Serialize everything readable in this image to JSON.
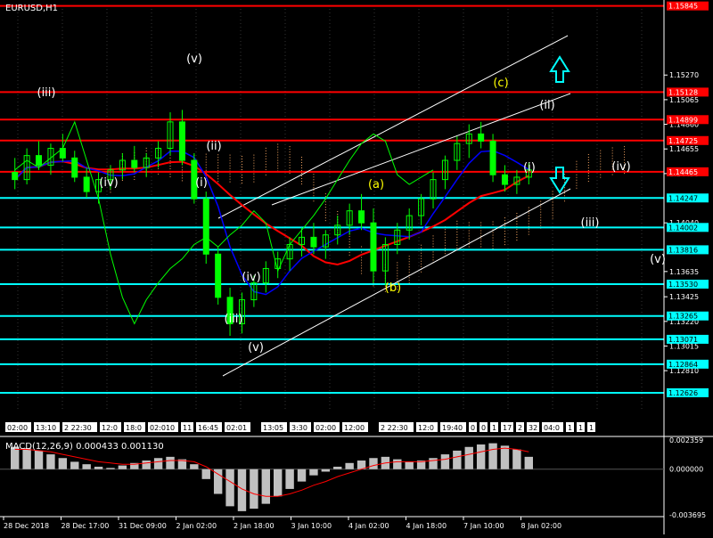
{
  "window": {
    "symbol_title": "EURUSD,H1",
    "macd_title": "MACD(12,26,9) 0.000433 0.001130"
  },
  "colors": {
    "background": "#000000",
    "candle": "#00ff00",
    "line_red": "#ff0000",
    "line_blue": "#0000ff",
    "level_red": "#ff0000",
    "level_cyan": "#00ffff",
    "channel": "#ffffff",
    "wave_white": "#ffffff",
    "wave_yellow": "#ffff00",
    "cloud": "#f4a460",
    "hist": "#c0c0c0",
    "macd_signal": "#ff0000"
  },
  "icons": {
    "up_arrow": "arrow-up-icon",
    "down_arrow": "arrow-down-icon"
  },
  "chart_data": {
    "type": "candlestick",
    "title": "EURUSD,H1",
    "y_axis": {
      "min": 1.1247,
      "max": 1.1585,
      "ticks": [
        "1.15270",
        "1.15065",
        "1.14860",
        "1.14655",
        "1.14450",
        "1.14040",
        "1.13635",
        "1.13425",
        "1.13220",
        "1.13015",
        "1.12810"
      ]
    },
    "price_levels": [
      {
        "value": 1.15845,
        "label": "1.15845",
        "color": "red"
      },
      {
        "value": 1.15128,
        "label": "1.15128",
        "color": "red"
      },
      {
        "value": 1.14899,
        "label": "1.14899",
        "color": "red"
      },
      {
        "value": 1.14725,
        "label": "1.14725",
        "color": "red"
      },
      {
        "value": 1.14465,
        "label": "1.14465",
        "color": "red"
      },
      {
        "value": 1.14247,
        "label": "1.14247",
        "color": "cyan"
      },
      {
        "value": 1.14002,
        "label": "1.14002",
        "color": "cyan"
      },
      {
        "value": 1.13816,
        "label": "1.13816",
        "color": "cyan"
      },
      {
        "value": 1.1353,
        "label": "1.13530",
        "color": "cyan"
      },
      {
        "value": 1.13265,
        "label": "1.13265",
        "color": "cyan"
      },
      {
        "value": 1.13071,
        "label": "1.13071",
        "color": "cyan"
      },
      {
        "value": 1.12864,
        "label": "1.12864",
        "color": "cyan"
      },
      {
        "value": 1.12626,
        "label": "1.12626",
        "color": "cyan"
      }
    ],
    "x_axis_labels": [
      "28 Dec 2018",
      "28 Dec 17:00",
      "31 Dec 09:00",
      "2 Jan 02:00",
      "2 Jan 18:00",
      "3 Jan 10:00",
      "4 Jan 02:00",
      "4 Jan 18:00",
      "7 Jan 10:00",
      "8 Jan 02:00"
    ],
    "time_markers": [
      "02:00",
      "13:10",
      "2 22:30",
      "12:0",
      "18:0",
      "02:010",
      "11",
      "16:45",
      "02:01",
      "13:05",
      "3:30",
      "02:00",
      "12:00",
      "2 22:30",
      "12:0",
      "19:40",
      "0",
      "0",
      "1",
      "17",
      "2",
      "32",
      "04:0",
      "1",
      "1",
      "1"
    ],
    "wave_labels": [
      {
        "text": "(iii)",
        "color": "white"
      },
      {
        "text": "(iv)",
        "color": "white"
      },
      {
        "text": "(v)",
        "color": "white"
      },
      {
        "text": "(ii)",
        "color": "white"
      },
      {
        "text": "(i)",
        "color": "white"
      },
      {
        "text": "(iv)",
        "color": "white"
      },
      {
        "text": "(iii)",
        "color": "white"
      },
      {
        "text": "(v)",
        "color": "white"
      },
      {
        "text": "(a)",
        "color": "yellow"
      },
      {
        "text": "(b)",
        "color": "yellow"
      },
      {
        "text": "(c)",
        "color": "yellow"
      },
      {
        "text": "(ii)",
        "color": "white"
      },
      {
        "text": "(i)",
        "color": "white"
      },
      {
        "text": "(iv)",
        "color": "white"
      },
      {
        "text": "(iii)",
        "color": "white"
      },
      {
        "text": "(v)",
        "color": "white"
      }
    ],
    "candles": [
      {
        "o": 1.1446,
        "h": 1.1458,
        "l": 1.1432,
        "c": 1.144
      },
      {
        "o": 1.144,
        "h": 1.1466,
        "l": 1.1436,
        "c": 1.146
      },
      {
        "o": 1.146,
        "h": 1.1472,
        "l": 1.1448,
        "c": 1.1452
      },
      {
        "o": 1.1452,
        "h": 1.147,
        "l": 1.1444,
        "c": 1.1466
      },
      {
        "o": 1.1466,
        "h": 1.1478,
        "l": 1.1455,
        "c": 1.1458
      },
      {
        "o": 1.1458,
        "h": 1.1464,
        "l": 1.1438,
        "c": 1.1442
      },
      {
        "o": 1.1442,
        "h": 1.145,
        "l": 1.1425,
        "c": 1.143
      },
      {
        "o": 1.143,
        "h": 1.1446,
        "l": 1.142,
        "c": 1.144
      },
      {
        "o": 1.144,
        "h": 1.1452,
        "l": 1.1432,
        "c": 1.1448
      },
      {
        "o": 1.1448,
        "h": 1.1462,
        "l": 1.144,
        "c": 1.1456
      },
      {
        "o": 1.1456,
        "h": 1.1468,
        "l": 1.1446,
        "c": 1.145
      },
      {
        "o": 1.145,
        "h": 1.1462,
        "l": 1.1442,
        "c": 1.1458
      },
      {
        "o": 1.1458,
        "h": 1.1472,
        "l": 1.145,
        "c": 1.1466
      },
      {
        "o": 1.1466,
        "h": 1.1496,
        "l": 1.146,
        "c": 1.1488
      },
      {
        "o": 1.1488,
        "h": 1.1498,
        "l": 1.1452,
        "c": 1.1456
      },
      {
        "o": 1.1456,
        "h": 1.1462,
        "l": 1.142,
        "c": 1.1424
      },
      {
        "o": 1.1424,
        "h": 1.143,
        "l": 1.137,
        "c": 1.1378
      },
      {
        "o": 1.1378,
        "h": 1.1384,
        "l": 1.1336,
        "c": 1.1342
      },
      {
        "o": 1.1342,
        "h": 1.135,
        "l": 1.131,
        "c": 1.132
      },
      {
        "o": 1.132,
        "h": 1.1346,
        "l": 1.1312,
        "c": 1.134
      },
      {
        "o": 1.134,
        "h": 1.136,
        "l": 1.1334,
        "c": 1.1354
      },
      {
        "o": 1.1354,
        "h": 1.1372,
        "l": 1.1346,
        "c": 1.1366
      },
      {
        "o": 1.1366,
        "h": 1.138,
        "l": 1.1358,
        "c": 1.1374
      },
      {
        "o": 1.1374,
        "h": 1.1392,
        "l": 1.1364,
        "c": 1.1386
      },
      {
        "o": 1.1386,
        "h": 1.14,
        "l": 1.1376,
        "c": 1.1392
      },
      {
        "o": 1.1392,
        "h": 1.1404,
        "l": 1.1378,
        "c": 1.1384
      },
      {
        "o": 1.1384,
        "h": 1.1398,
        "l": 1.1374,
        "c": 1.1394
      },
      {
        "o": 1.1394,
        "h": 1.141,
        "l": 1.1386,
        "c": 1.1402
      },
      {
        "o": 1.1402,
        "h": 1.142,
        "l": 1.1394,
        "c": 1.1414
      },
      {
        "o": 1.1414,
        "h": 1.1428,
        "l": 1.1398,
        "c": 1.1404
      },
      {
        "o": 1.1404,
        "h": 1.1416,
        "l": 1.1354,
        "c": 1.1364
      },
      {
        "o": 1.1364,
        "h": 1.1392,
        "l": 1.1352,
        "c": 1.1386
      },
      {
        "o": 1.1386,
        "h": 1.1404,
        "l": 1.1378,
        "c": 1.1398
      },
      {
        "o": 1.1398,
        "h": 1.1416,
        "l": 1.139,
        "c": 1.141
      },
      {
        "o": 1.141,
        "h": 1.1428,
        "l": 1.1402,
        "c": 1.1424
      },
      {
        "o": 1.1424,
        "h": 1.1446,
        "l": 1.1416,
        "c": 1.144
      },
      {
        "o": 1.144,
        "h": 1.146,
        "l": 1.1432,
        "c": 1.1456
      },
      {
        "o": 1.1456,
        "h": 1.1476,
        "l": 1.1448,
        "c": 1.147
      },
      {
        "o": 1.147,
        "h": 1.1486,
        "l": 1.1458,
        "c": 1.1478
      },
      {
        "o": 1.1478,
        "h": 1.1488,
        "l": 1.1466,
        "c": 1.1472
      },
      {
        "o": 1.1472,
        "h": 1.1478,
        "l": 1.1438,
        "c": 1.1444
      },
      {
        "o": 1.1444,
        "h": 1.1452,
        "l": 1.143,
        "c": 1.1436
      },
      {
        "o": 1.1436,
        "h": 1.1448,
        "l": 1.1428,
        "c": 1.1442
      },
      {
        "o": 1.1442,
        "h": 1.1454,
        "l": 1.1436,
        "c": 1.1448
      }
    ]
  },
  "macd": {
    "axis_labels": [
      "0.002359",
      "0.000000",
      "-0.003695"
    ],
    "histogram": [
      0.0018,
      0.0017,
      0.0015,
      0.0012,
      0.0009,
      0.0006,
      0.0004,
      0.0002,
      0.0001,
      0.0003,
      0.0005,
      0.0007,
      0.0009,
      0.001,
      0.0008,
      0.0004,
      -0.0008,
      -0.002,
      -0.003,
      -0.0034,
      -0.0032,
      -0.0028,
      -0.0022,
      -0.0016,
      -0.001,
      -0.0005,
      -0.0002,
      0.0002,
      0.0005,
      0.0007,
      0.0009,
      0.001,
      0.0008,
      0.0006,
      0.0007,
      0.0009,
      0.0012,
      0.0015,
      0.0018,
      0.002,
      0.0021,
      0.0019,
      0.0016,
      0.001
    ],
    "signal": [
      0.0016,
      0.0016,
      0.0015,
      0.0014,
      0.0012,
      0.001,
      0.0008,
      0.0006,
      0.0005,
      0.0004,
      0.0004,
      0.0005,
      0.0006,
      0.0007,
      0.0007,
      0.0006,
      0.0002,
      -0.0004,
      -0.001,
      -0.0016,
      -0.002,
      -0.0022,
      -0.0022,
      -0.002,
      -0.0017,
      -0.0013,
      -0.001,
      -0.0006,
      -0.0003,
      0.0,
      0.0003,
      0.0005,
      0.0006,
      0.0006,
      0.0006,
      0.0007,
      0.0008,
      0.001,
      0.0012,
      0.0014,
      0.0016,
      0.0017,
      0.0016,
      0.0014
    ],
    "ylim": [
      -0.003695,
      0.002359
    ]
  }
}
